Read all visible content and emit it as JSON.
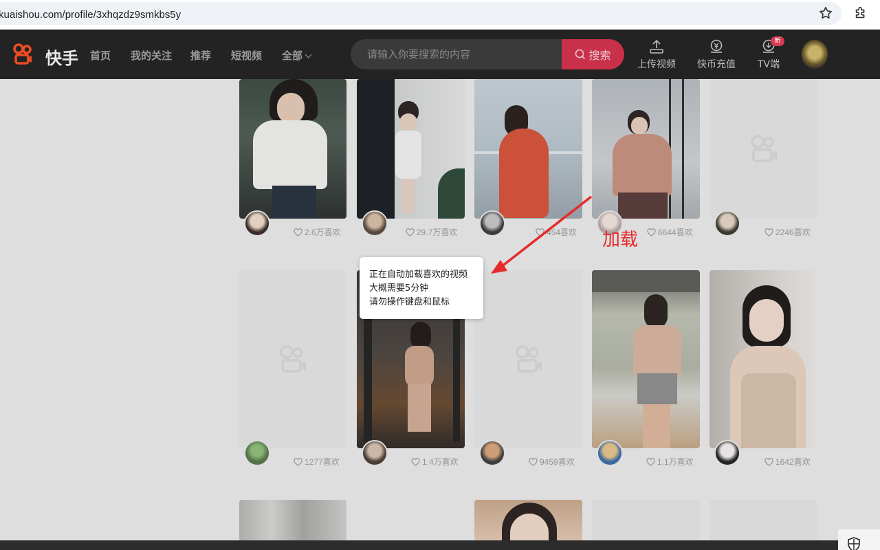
{
  "browser": {
    "url": "kuaishou.com/profile/3xhqzdz9smkbs5y"
  },
  "header": {
    "logo_text": "快手",
    "nav": [
      "首页",
      "我的关注",
      "推荐",
      "短视频"
    ],
    "nav_all": "全部",
    "search_placeholder": "请输入你要搜索的内容",
    "search_button": "搜索",
    "actions": {
      "upload": "上传视频",
      "recharge": "快币充值",
      "tv": "TV端",
      "tv_badge": "新"
    },
    "accent_color": "#c9304a"
  },
  "cards": [
    {
      "likes": "2.6万喜欢"
    },
    {
      "likes": "29.7万喜欢"
    },
    {
      "likes": "454喜欢"
    },
    {
      "likes": "6644喜欢"
    },
    {
      "likes": "2246喜欢"
    },
    {
      "likes": "1277喜欢"
    },
    {
      "likes": "1.4万喜欢"
    },
    {
      "likes": "9459喜欢"
    },
    {
      "likes": "1.1万喜欢"
    },
    {
      "likes": "1642喜欢"
    }
  ],
  "tooltip": {
    "line1": "正在自动加载喜欢的视频",
    "line2": "大概需要5分钟",
    "line3": "请勿操作键盘和鼠标"
  },
  "annotation": {
    "text": "加载",
    "color": "#e52b2b"
  }
}
